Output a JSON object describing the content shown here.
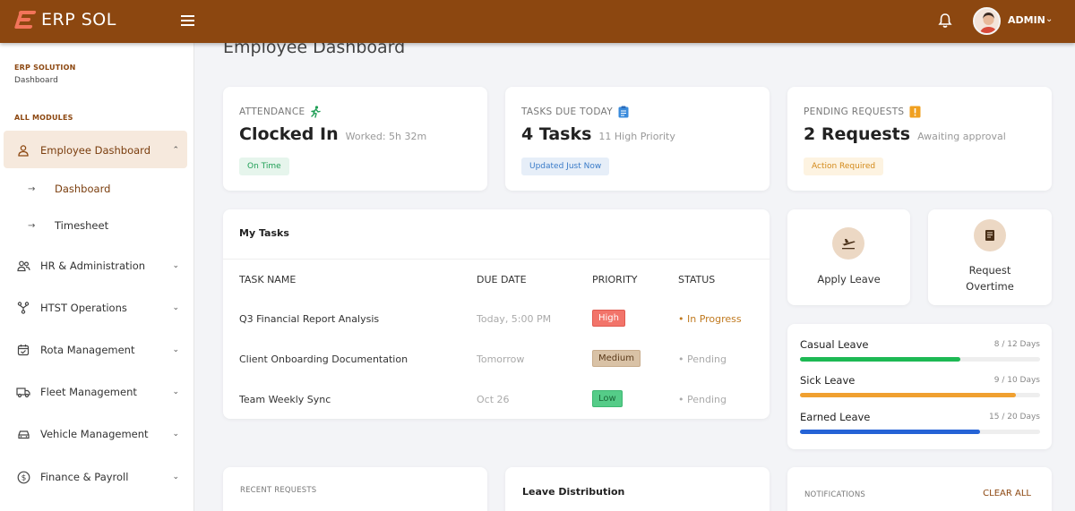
{
  "header": {
    "logo_text": "ERP SOL",
    "user_name": "ADMIN",
    "colors": {
      "header_bg": "#8c4710",
      "logo_accent": "#f2745a"
    }
  },
  "sidebar": {
    "org": "ERP SOLUTION",
    "crumb": "Dashboard",
    "section": "ALL MODULES",
    "items": [
      {
        "label": "Employee Dashboard",
        "icon": "user-icon",
        "expanded": true
      },
      {
        "label": "HR & Administration",
        "icon": "users-icon"
      },
      {
        "label": "HTST Operations",
        "icon": "network-icon"
      },
      {
        "label": "Rota Management",
        "icon": "calendar-icon"
      },
      {
        "label": "Fleet Management",
        "icon": "truck-icon"
      },
      {
        "label": "Vehicle Management",
        "icon": "car-icon"
      },
      {
        "label": "Finance & Payroll",
        "icon": "dollar-icon"
      }
    ],
    "children": [
      {
        "label": "Dashboard",
        "active": true
      },
      {
        "label": "Timesheet"
      }
    ]
  },
  "page": {
    "title": "Employee Dashboard"
  },
  "stats": [
    {
      "label": "ATTENDANCE",
      "icon": "running-person-icon",
      "value": "Clocked In",
      "note": "Worked: 5h 32m",
      "pill": "On Time",
      "pill_color": "#1e9e55",
      "pill_bg": "#e6f5ec"
    },
    {
      "label": "TASKS DUE TODAY",
      "icon": "clipboard-icon",
      "value": "4 Tasks",
      "note": "11 High Priority",
      "pill": "Updated Just Now",
      "pill_color": "#3a7bc8",
      "pill_bg": "#e6eef8"
    },
    {
      "label": "PENDING REQUESTS",
      "icon": "alert-icon",
      "value": "2 Requests",
      "note": "Awaiting approval",
      "pill": "Action Required",
      "pill_color": "#d38a1a",
      "pill_bg": "#fdf3e1"
    }
  ],
  "tasks": {
    "title": "My Tasks",
    "columns": [
      "TASK NAME",
      "DUE DATE",
      "PRIORITY",
      "STATUS"
    ],
    "rows": [
      {
        "name": "Q3 Financial Report Analysis",
        "due": "Today, 5:00 PM",
        "priority": "High",
        "status": "• In Progress"
      },
      {
        "name": "Client Onboarding Documentation",
        "due": "Tomorrow",
        "priority": "Medium",
        "status": "• Pending"
      },
      {
        "name": "Team Weekly Sync",
        "due": "Oct 26",
        "priority": "Low",
        "status": "• Pending"
      }
    ]
  },
  "actions": [
    {
      "label": "Apply Leave",
      "icon": "plane-icon"
    },
    {
      "label": "Request Overtime",
      "icon": "document-icon"
    }
  ],
  "leave": [
    {
      "name": "Casual Leave",
      "count": "8 / 12 Days",
      "used": 8,
      "total": 12,
      "color": "#1db954"
    },
    {
      "name": "Sick Leave",
      "count": "9 / 10 Days",
      "used": 9,
      "total": 10,
      "color": "#f0a030"
    },
    {
      "name": "Earned Leave",
      "count": "15 / 20 Days",
      "used": 15,
      "total": 20,
      "color": "#2563d6"
    }
  ],
  "bottom": {
    "recent_requests": "RECENT REQUESTS",
    "leave_distribution": "Leave Distribution",
    "notifications": "NOTIFICATIONS",
    "clear_all": "CLEAR ALL"
  }
}
